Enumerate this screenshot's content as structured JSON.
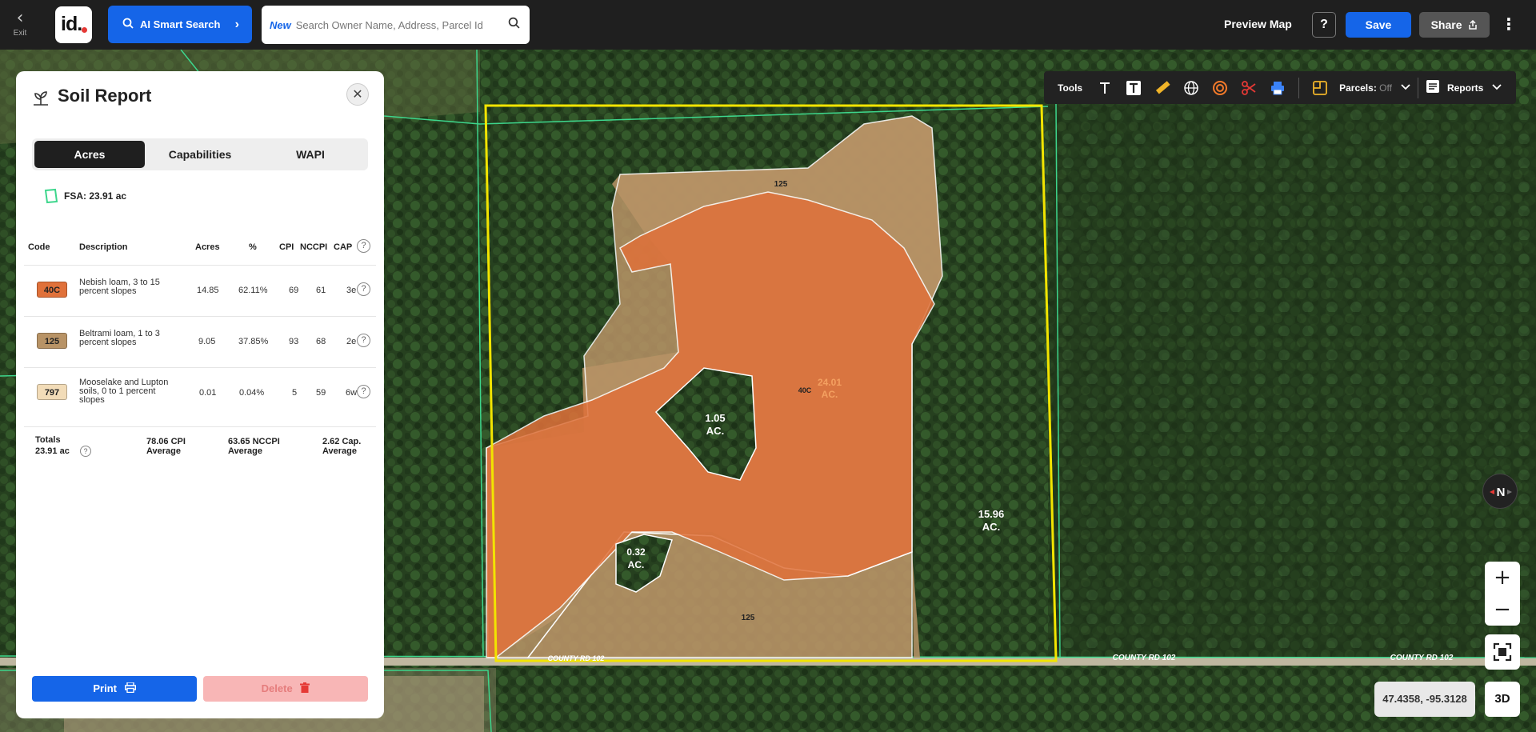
{
  "topbar": {
    "exit_label": "Exit",
    "logo_text": "id.",
    "ai_search_label": "AI Smart Search",
    "search_new_tag": "New",
    "search_placeholder": "Search Owner Name, Address, Parcel Id",
    "preview_map_label": "Preview Map",
    "help_label": "?",
    "save_label": "Save",
    "share_label": "Share"
  },
  "toolbar": {
    "tools_label": "Tools",
    "parcels_label": "Parcels:",
    "parcels_state": "Off",
    "reports_label": "Reports",
    "icons": [
      "text-icon",
      "text-box-icon",
      "ruler-icon",
      "globe-icon",
      "buffer-icon",
      "scissors-icon",
      "printer-icon",
      "parcel-icon"
    ]
  },
  "map": {
    "labels": {
      "soil_125_top": "125",
      "soil_125_bottom": "125",
      "soil_40c": "40C",
      "acres_main": [
        "24.01",
        "AC."
      ],
      "acres_island1": [
        "1.05",
        "AC."
      ],
      "acres_island2": [
        "0.32",
        "AC."
      ],
      "acres_east": [
        "15.96",
        "AC."
      ],
      "road_1": "COUNTY RD 102",
      "road_2": "COUNTY RD 102",
      "road_3": "COUNTY RD 102"
    },
    "colors": {
      "soil_40c": "#e0713a",
      "soil_125": "#b89366",
      "field_outline": "#f2e400",
      "parcel_lines": "#3dd68c"
    },
    "compass_letter": "N",
    "zoom_in": "+",
    "zoom_out": "−",
    "coordinates": "47.4358, -95.3128",
    "btn_3d": "3D"
  },
  "soil_report": {
    "title": "Soil Report",
    "tabs": [
      {
        "label": "Acres",
        "active": true
      },
      {
        "label": "Capabilities",
        "active": false
      },
      {
        "label": "WAPI",
        "active": false
      }
    ],
    "fsa_label": "FSA: 23.91 ac",
    "columns": {
      "code": "Code",
      "description": "Description",
      "acres": "Acres",
      "pct": "%",
      "cpi": "CPI",
      "nccpi": "NCCPI",
      "cap": "CAP"
    },
    "rows": [
      {
        "code": "40C",
        "color": "#e0713a",
        "desc_lines": [
          "Nebish loam, 3 to 15",
          "percent slopes"
        ],
        "acres": "14.85",
        "pct": "62.11%",
        "cpi": "69",
        "nccpi": "61",
        "cap": "3e"
      },
      {
        "code": "125",
        "color": "#b89366",
        "desc_lines": [
          "Beltrami loam, 1 to 3",
          "percent slopes"
        ],
        "acres": "9.05",
        "pct": "37.85%",
        "cpi": "93",
        "nccpi": "68",
        "cap": "2e"
      },
      {
        "code": "797",
        "color": "#f2dcb8",
        "desc_lines": [
          "Mooselake and Lupton",
          "soils, 0 to 1 percent",
          "slopes"
        ],
        "acres": "0.01",
        "pct": "0.04%",
        "cpi": "5",
        "nccpi": "59",
        "cap": "6w"
      }
    ],
    "totals": {
      "label": "Totals",
      "acres": "23.91 ac",
      "cpi_value": "78.06 CPI",
      "cpi_sub": "Average",
      "nccpi_value": "63.65 NCCPI",
      "nccpi_sub": "Average",
      "cap_value": "2.62 Cap.",
      "cap_sub": "Average"
    },
    "print_label": "Print",
    "delete_label": "Delete"
  }
}
